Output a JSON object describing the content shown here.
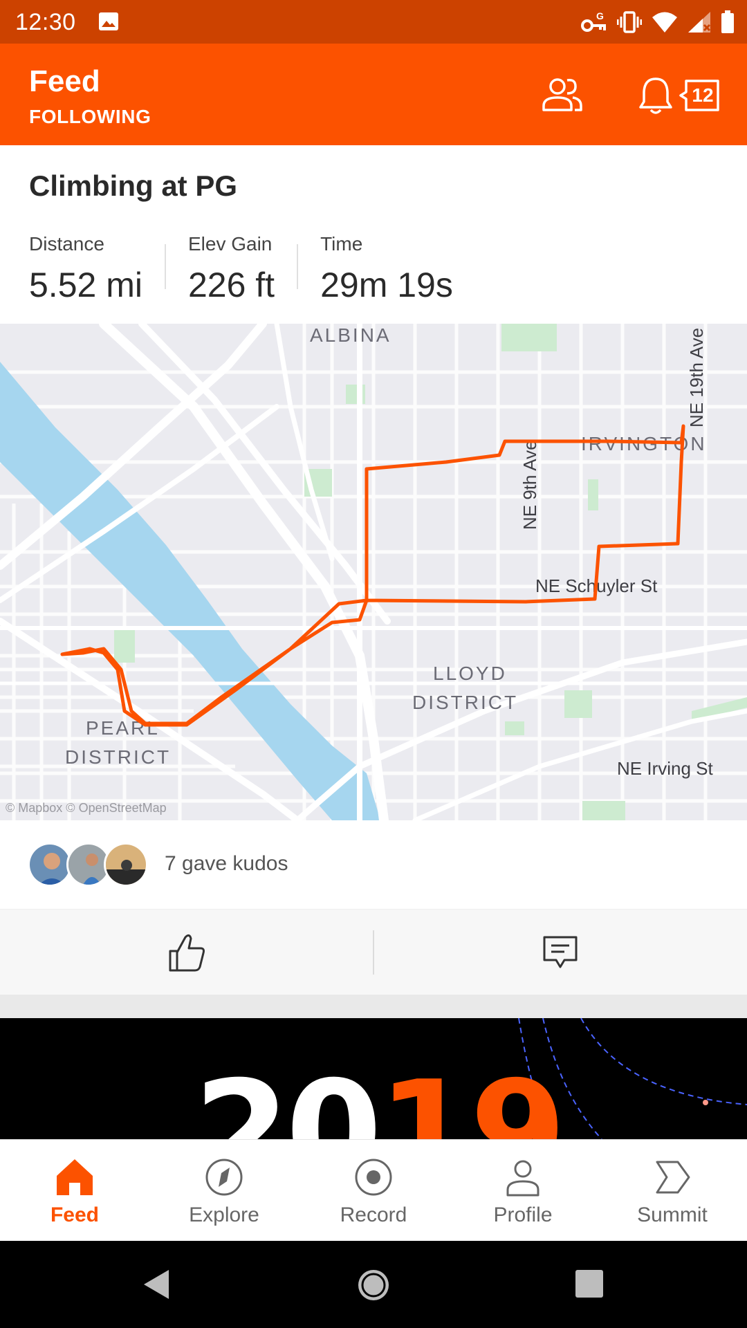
{
  "status_bar": {
    "time": "12:30",
    "icons": [
      "image-icon",
      "vpn-key-icon",
      "vibrate-icon",
      "wifi-icon",
      "signal-icon",
      "battery-icon"
    ]
  },
  "header": {
    "title": "Feed",
    "subtitle": "FOLLOWING",
    "notification_count": "12",
    "icons": [
      "friends-icon",
      "bell-icon"
    ]
  },
  "activity": {
    "title": "Climbing at PG",
    "stats": [
      {
        "label": "Distance",
        "value": "5.52 mi"
      },
      {
        "label": "Elev Gain",
        "value": "226 ft"
      },
      {
        "label": "Time",
        "value": "29m 19s"
      }
    ]
  },
  "map": {
    "labels": {
      "albina": "ALBINA",
      "irvington": "IRVINGTON",
      "lloyd_1": "LLOYD",
      "lloyd_2": "DISTRICT",
      "pearl_1": "PEARL",
      "pearl_2": "DISTRICT",
      "ne9th": "NE 9th Ave",
      "ne19th": "NE 19th Ave",
      "schuyler": "NE Schuyler St",
      "irving": "NE Irving St",
      "attribution": "© Mapbox © OpenStreetMap"
    },
    "route_color": "#fc5200",
    "water_color": "#a6d6ef"
  },
  "kudos": {
    "text": "7 gave kudos"
  },
  "actions": {
    "icons": [
      "thumbs-up-icon",
      "comment-icon"
    ]
  },
  "promo": {
    "year_white": "20",
    "year_orange": "19"
  },
  "bottom_nav": [
    {
      "label": "Feed",
      "icon": "home-icon",
      "active": true
    },
    {
      "label": "Explore",
      "icon": "compass-icon",
      "active": false
    },
    {
      "label": "Record",
      "icon": "record-icon",
      "active": false
    },
    {
      "label": "Profile",
      "icon": "person-icon",
      "active": false
    },
    {
      "label": "Summit",
      "icon": "summit-icon",
      "active": false
    }
  ],
  "colors": {
    "brand": "#fc5200",
    "status_bar": "#cc4200"
  }
}
